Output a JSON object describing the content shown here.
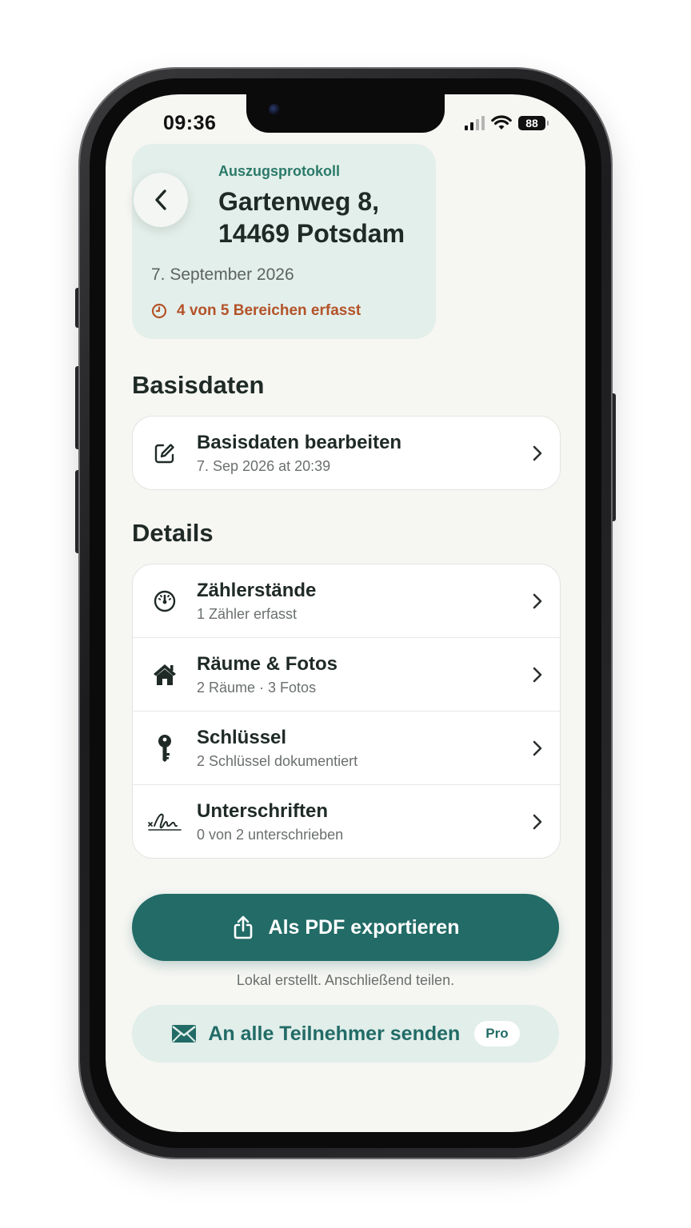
{
  "status_bar": {
    "time": "09:36",
    "battery": "88"
  },
  "header": {
    "kicker": "Auszugsprotokoll",
    "title_line1": "Gartenweg 8,",
    "title_line2": "14469 Potsdam",
    "date": "7. September 2026",
    "progress": "4 von 5 Bereichen erfasst",
    "progress_color": "#b4532a"
  },
  "basisdaten": {
    "section_title": "Basisdaten",
    "row": {
      "title": "Basisdaten bearbeiten",
      "subtitle": "7. Sep 2026 at 20:39",
      "icon": "edit-icon"
    }
  },
  "details": {
    "section_title": "Details",
    "rows": [
      {
        "title": "Zählerstände",
        "subtitle": "1 Zähler erfasst",
        "icon": "gauge-icon"
      },
      {
        "title": "Räume & Fotos",
        "subtitle": "2 Räume · 3 Fotos",
        "icon": "house-icon"
      },
      {
        "title": "Schlüssel",
        "subtitle": "2 Schlüssel dokumentiert",
        "icon": "key-icon"
      },
      {
        "title": "Unterschriften",
        "subtitle": "0 von 2 unterschrieben",
        "icon": "signature-icon"
      }
    ]
  },
  "actions": {
    "export_label": "Als PDF exportieren",
    "export_hint": "Lokal erstellt. Anschließend teilen.",
    "send_label": "An alle Teilnehmer senden",
    "pro_badge": "Pro",
    "accent_color": "#226b66"
  }
}
